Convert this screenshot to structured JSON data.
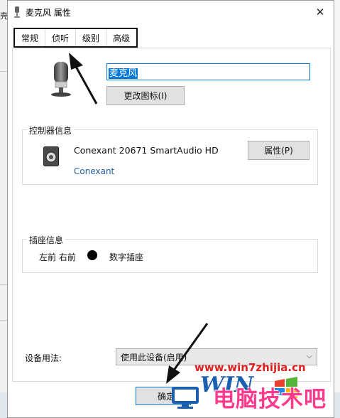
{
  "background": {
    "left_char": "壳"
  },
  "window": {
    "title": "麦克风 属性",
    "close_glyph": "✕"
  },
  "tabs": [
    {
      "label": "常规",
      "active": true
    },
    {
      "label": "侦听",
      "active": false
    },
    {
      "label": "级别",
      "active": false
    },
    {
      "label": "高级",
      "active": false
    }
  ],
  "device": {
    "name_value": "麦克风",
    "change_icon_label": "更改图标(I)"
  },
  "controller": {
    "group_label": "控制器信息",
    "name": "Conexant 20671 SmartAudio HD",
    "vendor": "Conexant",
    "properties_label": "属性(P)"
  },
  "jack": {
    "group_label": "插座信息",
    "position": "左前 右前",
    "type": "数字插座"
  },
  "usage": {
    "label": "设备用法:",
    "selected": "使用此设备(启用)",
    "caret": "⌵"
  },
  "footer": {
    "ok_label": "确定"
  },
  "watermark": {
    "site": "www.win7zhijia.cn",
    "logo": "WIN",
    "brand": "电脑技术吧"
  },
  "colors": {
    "accent": "#0078d7",
    "link": "#1f5c99",
    "watermark_red": "#e02020",
    "watermark_pink": "#ff3b8d"
  }
}
